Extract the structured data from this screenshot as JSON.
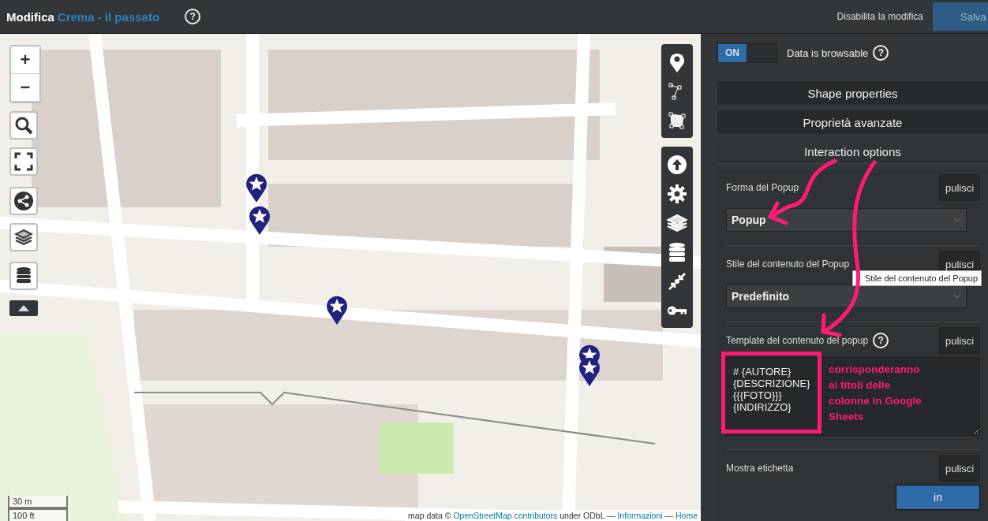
{
  "header": {
    "action": "Modifica",
    "map_name": "Crema - il passato",
    "help": "?",
    "disable_edit": "Disabilita la modifica",
    "save": "Salva"
  },
  "map": {
    "zoom_in": "+",
    "zoom_out": "−",
    "scale": [
      "30 m",
      "100 ft"
    ],
    "attribution": [
      {
        "kind": "text",
        "text": "map data © "
      },
      {
        "kind": "link",
        "text": "OpenStreetMap contributors"
      },
      {
        "kind": "text",
        "text": " under ODbL — "
      },
      {
        "kind": "link",
        "text": "Informazioni"
      },
      {
        "kind": "text",
        "text": " — "
      },
      {
        "kind": "link",
        "text": "Home"
      }
    ]
  },
  "browsable": {
    "toggle": "ON",
    "on": true,
    "label": "Data is browsable",
    "help": "?"
  },
  "sections": [
    {
      "title": "Shape properties",
      "expanded": false
    },
    {
      "title": "Proprietà avanzate",
      "expanded": false
    },
    {
      "title": "Interaction options",
      "expanded": true
    }
  ],
  "fields": [
    {
      "kind": "select",
      "label": "Forma del Popup",
      "clear": "pulisci",
      "value": "Popup"
    },
    {
      "kind": "select",
      "label": "Stile del contenuto del Popup",
      "clear": "pulisci",
      "value": "Predefinito",
      "tooltip": "Stile del contenuto del Popup"
    },
    {
      "kind": "textarea",
      "label": "Template del contenuto del popup",
      "help": "?",
      "clear": "pulisci",
      "value": "# {AUTORE}\n{DESCRIZIONE}\n{{{FOTO}}}\n{INDIRIZZO}",
      "note": "corrisponderanno ai titoli delle colonne in Google Sheets"
    },
    {
      "kind": "buttons",
      "label": "Mostra etichetta",
      "clear": "pulisci",
      "button": "in"
    }
  ]
}
